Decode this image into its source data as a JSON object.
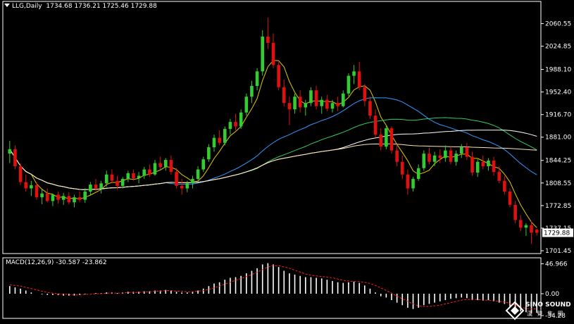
{
  "header": {
    "symbol_label": "LLG,Daily",
    "ohlc": "1734.68 1736.21 1725.46 1729.88"
  },
  "macd_header": "MACD(12,26,9) -30.587 -23.862",
  "watermark": {
    "brand": "SINO SOUND",
    "subtitle": "漢 聲 集 團"
  },
  "colors": {
    "background": "#000000",
    "axis": "#ffffff",
    "bull_candle": "#33cc33",
    "bear_candle": "#e01010",
    "ma_fast": "#e8c800",
    "ma_mid": "#3399ff",
    "ma_slow": "#33cc66",
    "ma_long": "#ffffff",
    "ma_extra": "#ffe4b5",
    "macd_hist": "#ffffff",
    "macd_signal": "#ff2020",
    "price_tag_bg": "#ffffff",
    "price_tag_text": "#000000"
  },
  "chart_data": [
    {
      "type": "candlestick",
      "panel": "price",
      "price_axis_ticks": [
        "2060.55",
        "2024.85",
        "1988.10",
        "1952.40",
        "1916.70",
        "1881.00",
        "1844.25",
        "1808.55",
        "1772.85",
        "1737.15",
        "1701.45"
      ],
      "ylim": [
        1697,
        2080
      ],
      "current_price": "1729.88",
      "candles": [
        [
          1855,
          1875,
          1840,
          1862
        ],
        [
          1862,
          1868,
          1830,
          1835
        ],
        [
          1835,
          1840,
          1805,
          1810
        ],
        [
          1810,
          1822,
          1795,
          1800
        ],
        [
          1800,
          1812,
          1788,
          1805
        ],
        [
          1805,
          1810,
          1782,
          1786
        ],
        [
          1786,
          1798,
          1775,
          1792
        ],
        [
          1792,
          1800,
          1778,
          1780
        ],
        [
          1780,
          1792,
          1772,
          1790
        ],
        [
          1790,
          1795,
          1776,
          1782
        ],
        [
          1782,
          1793,
          1774,
          1788
        ],
        [
          1788,
          1794,
          1775,
          1778
        ],
        [
          1778,
          1790,
          1770,
          1786
        ],
        [
          1786,
          1795,
          1778,
          1782
        ],
        [
          1782,
          1800,
          1777,
          1795
        ],
        [
          1795,
          1810,
          1790,
          1806
        ],
        [
          1806,
          1815,
          1796,
          1800
        ],
        [
          1800,
          1812,
          1792,
          1808
        ],
        [
          1808,
          1828,
          1803,
          1822
        ],
        [
          1822,
          1830,
          1808,
          1812
        ],
        [
          1812,
          1820,
          1798,
          1804
        ],
        [
          1804,
          1818,
          1800,
          1815
        ],
        [
          1815,
          1828,
          1810,
          1824
        ],
        [
          1824,
          1830,
          1812,
          1816
        ],
        [
          1816,
          1826,
          1808,
          1820
        ],
        [
          1820,
          1834,
          1815,
          1830
        ],
        [
          1830,
          1838,
          1818,
          1822
        ],
        [
          1822,
          1845,
          1820,
          1840
        ],
        [
          1840,
          1850,
          1830,
          1834
        ],
        [
          1834,
          1848,
          1828,
          1845
        ],
        [
          1845,
          1852,
          1822,
          1826
        ],
        [
          1826,
          1832,
          1800,
          1804
        ],
        [
          1804,
          1815,
          1790,
          1800
        ],
        [
          1800,
          1812,
          1794,
          1808
        ],
        [
          1808,
          1820,
          1800,
          1815
        ],
        [
          1815,
          1835,
          1812,
          1830
        ],
        [
          1830,
          1850,
          1826,
          1846
        ],
        [
          1846,
          1870,
          1842,
          1865
        ],
        [
          1865,
          1885,
          1858,
          1880
        ],
        [
          1880,
          1892,
          1868,
          1872
        ],
        [
          1872,
          1898,
          1868,
          1894
        ],
        [
          1894,
          1910,
          1885,
          1905
        ],
        [
          1905,
          1918,
          1892,
          1898
        ],
        [
          1898,
          1925,
          1894,
          1920
        ],
        [
          1920,
          1950,
          1915,
          1945
        ],
        [
          1945,
          1970,
          1935,
          1962
        ],
        [
          1962,
          1990,
          1955,
          1985
        ],
        [
          1985,
          2050,
          1978,
          2040
        ],
        [
          2040,
          2070,
          2020,
          2030
        ],
        [
          2030,
          2045,
          1990,
          1995
        ],
        [
          1995,
          2000,
          1955,
          1960
        ],
        [
          1960,
          1972,
          1930,
          1935
        ],
        [
          1935,
          1945,
          1900,
          1925
        ],
        [
          1925,
          1950,
          1918,
          1945
        ],
        [
          1945,
          1955,
          1920,
          1928
        ],
        [
          1928,
          1940,
          1915,
          1935
        ],
        [
          1935,
          1960,
          1930,
          1955
        ],
        [
          1955,
          1962,
          1925,
          1930
        ],
        [
          1930,
          1945,
          1918,
          1940
        ],
        [
          1940,
          1948,
          1922,
          1926
        ],
        [
          1926,
          1940,
          1920,
          1935
        ],
        [
          1935,
          1945,
          1922,
          1930
        ],
        [
          1930,
          1955,
          1928,
          1950
        ],
        [
          1950,
          1982,
          1946,
          1978
        ],
        [
          1978,
          1995,
          1965,
          1985
        ],
        [
          1985,
          2000,
          1955,
          1960
        ],
        [
          1960,
          1965,
          1930,
          1938
        ],
        [
          1938,
          1945,
          1910,
          1915
        ],
        [
          1915,
          1925,
          1880,
          1885
        ],
        [
          1885,
          1895,
          1860,
          1866
        ],
        [
          1866,
          1900,
          1862,
          1895
        ],
        [
          1895,
          1898,
          1855,
          1860
        ],
        [
          1860,
          1870,
          1835,
          1842
        ],
        [
          1842,
          1852,
          1815,
          1822
        ],
        [
          1822,
          1830,
          1790,
          1800
        ],
        [
          1800,
          1818,
          1795,
          1815
        ],
        [
          1815,
          1838,
          1812,
          1832
        ],
        [
          1832,
          1860,
          1828,
          1855
        ],
        [
          1855,
          1865,
          1838,
          1842
        ],
        [
          1842,
          1858,
          1835,
          1852
        ],
        [
          1852,
          1862,
          1840,
          1848
        ],
        [
          1848,
          1868,
          1842,
          1860
        ],
        [
          1860,
          1866,
          1838,
          1842
        ],
        [
          1842,
          1860,
          1836,
          1855
        ],
        [
          1855,
          1870,
          1848,
          1865
        ],
        [
          1865,
          1872,
          1845,
          1850
        ],
        [
          1850,
          1858,
          1820,
          1825
        ],
        [
          1825,
          1846,
          1818,
          1842
        ],
        [
          1842,
          1852,
          1830,
          1835
        ],
        [
          1835,
          1848,
          1828,
          1844
        ],
        [
          1844,
          1850,
          1820,
          1826
        ],
        [
          1826,
          1835,
          1808,
          1812
        ],
        [
          1812,
          1820,
          1790,
          1795
        ],
        [
          1795,
          1800,
          1770,
          1774
        ],
        [
          1774,
          1780,
          1745,
          1750
        ],
        [
          1750,
          1758,
          1732,
          1738
        ],
        [
          1738,
          1745,
          1725,
          1742
        ],
        [
          1742,
          1748,
          1712,
          1730
        ],
        [
          1734.68,
          1736.21,
          1725.46,
          1729.88
        ]
      ]
    },
    {
      "type": "macd",
      "panel": "macd",
      "name": "MACD(12,26,9)",
      "values_shown": [
        -30.587,
        -23.862
      ],
      "axis_ticks": [
        "46.966",
        "0.00",
        "-34.28"
      ],
      "ylim": [
        -34.28,
        52
      ],
      "histogram": [
        12,
        10,
        8,
        5,
        2,
        0,
        -1,
        -2,
        -2,
        -2,
        -3,
        -3,
        -3,
        -2,
        -1,
        0,
        1,
        1,
        2,
        2,
        1,
        2,
        3,
        3,
        3,
        4,
        4,
        5,
        5,
        6,
        5,
        3,
        2,
        2,
        3,
        5,
        8,
        12,
        16,
        18,
        22,
        25,
        26,
        28,
        32,
        36,
        40,
        46,
        48,
        46,
        42,
        36,
        32,
        30,
        28,
        26,
        26,
        25,
        24,
        22,
        20,
        18,
        17,
        18,
        19,
        17,
        13,
        8,
        2,
        -4,
        -6,
        -10,
        -14,
        -18,
        -22,
        -24,
        -22,
        -18,
        -16,
        -14,
        -12,
        -10,
        -8,
        -7,
        -6,
        -7,
        -10,
        -10,
        -11,
        -10,
        -12,
        -14,
        -16,
        -20,
        -24,
        -28,
        -29,
        -31,
        -30
      ],
      "signal": [
        14,
        13,
        12,
        10,
        8,
        6,
        4,
        2,
        1,
        0,
        -1,
        -1,
        -2,
        -2,
        -1,
        -1,
        0,
        0,
        1,
        1,
        1,
        1,
        2,
        2,
        2,
        3,
        3,
        4,
        4,
        5,
        5,
        4,
        4,
        3,
        3,
        4,
        5,
        7,
        9,
        12,
        15,
        18,
        21,
        24,
        27,
        30,
        34,
        38,
        42,
        44,
        44,
        42,
        40,
        37,
        34,
        31,
        29,
        28,
        27,
        26,
        25,
        23,
        21,
        20,
        19,
        19,
        18,
        16,
        13,
        9,
        5,
        1,
        -4,
        -8,
        -12,
        -16,
        -19,
        -20,
        -20,
        -19,
        -18,
        -16,
        -14,
        -12,
        -10,
        -9,
        -9,
        -9,
        -10,
        -10,
        -11,
        -12,
        -13,
        -15,
        -18,
        -21,
        -23,
        -24,
        -23.862
      ]
    }
  ]
}
